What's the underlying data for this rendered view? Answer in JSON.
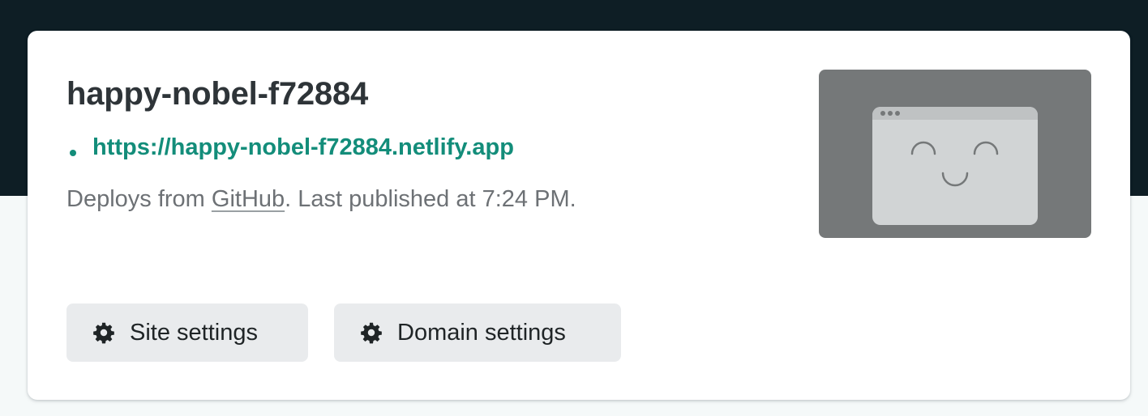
{
  "site": {
    "name": "happy-nobel-f72884",
    "url": "https://happy-nobel-f72884.netlify.app",
    "status": "published",
    "deploy_prefix": "Deploys from ",
    "deploy_provider": "GitHub",
    "deploy_suffix": ". Last published at 7:24 PM."
  },
  "actions": {
    "site_settings_label": "Site settings",
    "domain_settings_label": "Domain settings",
    "icon": "gear-icon"
  },
  "preview": {
    "icon": "smiley-browser-icon"
  },
  "colors": {
    "header_band": "#0e1e25",
    "page_background": "#f5f9f9",
    "accent": "#138d7a",
    "button_background": "#e9ebed",
    "preview_background": "#757879"
  }
}
